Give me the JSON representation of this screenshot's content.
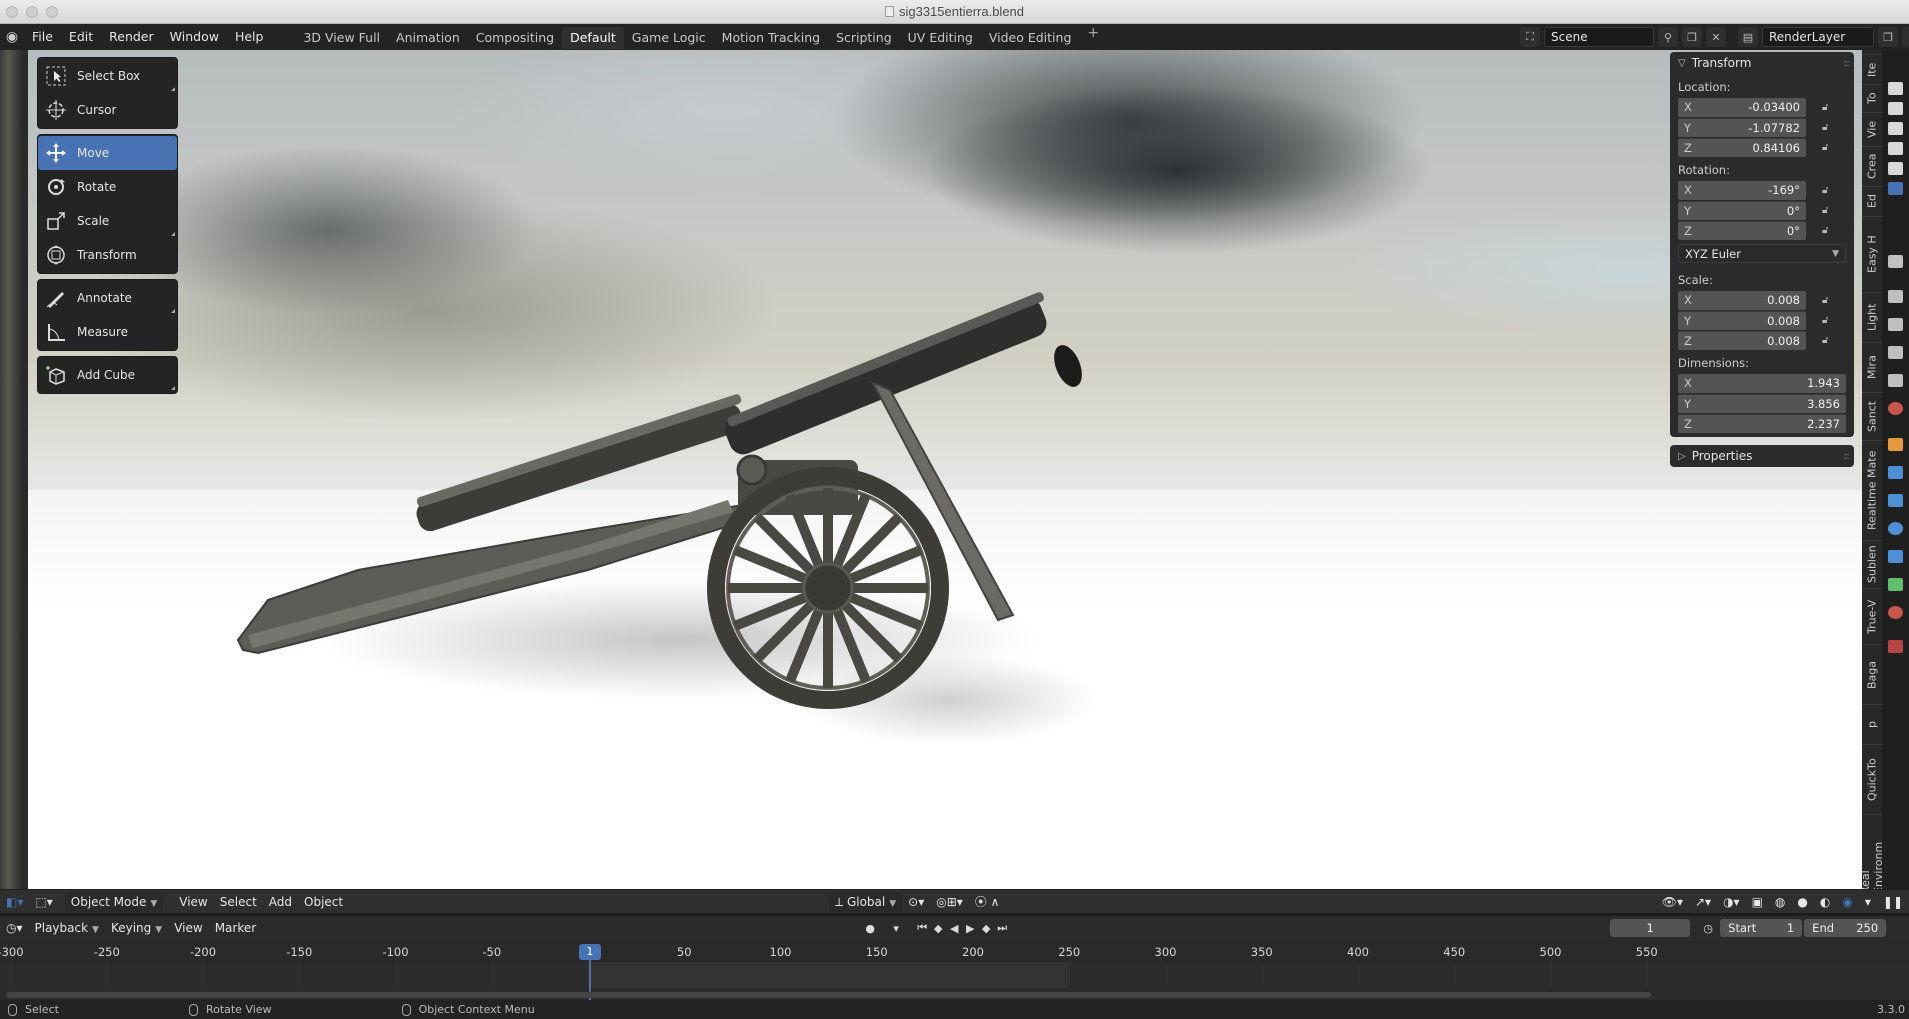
{
  "window": {
    "title": "sig3315entierra.blend"
  },
  "topbar": {
    "menus": [
      "File",
      "Edit",
      "Render",
      "Window",
      "Help"
    ],
    "workspaces": [
      "3D View Full",
      "Animation",
      "Compositing",
      "Default",
      "Game Logic",
      "Motion Tracking",
      "Scripting",
      "UV Editing",
      "Video Editing"
    ],
    "active_workspace": "Default",
    "add_tab": "+",
    "scene": "Scene",
    "view_layer": "RenderLayer"
  },
  "toolbar": {
    "groups": [
      [
        {
          "label": "Select Box",
          "icon": "select-box-icon"
        },
        {
          "label": "Cursor",
          "icon": "cursor-icon"
        }
      ],
      [
        {
          "label": "Move",
          "icon": "move-icon",
          "active": true
        },
        {
          "label": "Rotate",
          "icon": "rotate-icon"
        },
        {
          "label": "Scale",
          "icon": "scale-icon"
        },
        {
          "label": "Transform",
          "icon": "transform-icon"
        }
      ],
      [
        {
          "label": "Annotate",
          "icon": "annotate-icon"
        },
        {
          "label": "Measure",
          "icon": "measure-icon"
        }
      ],
      [
        {
          "label": "Add Cube",
          "icon": "add-cube-icon"
        }
      ]
    ]
  },
  "transform_panel": {
    "title": "Transform",
    "location_label": "Location:",
    "location": [
      {
        "axis": "X",
        "value": "-0.03400"
      },
      {
        "axis": "Y",
        "value": "-1.07782"
      },
      {
        "axis": "Z",
        "value": "0.84106"
      }
    ],
    "rotation_label": "Rotation:",
    "rotation": [
      {
        "axis": "X",
        "value": "-169°"
      },
      {
        "axis": "Y",
        "value": "0°"
      },
      {
        "axis": "Z",
        "value": "0°"
      }
    ],
    "rotation_mode": "XYZ Euler",
    "scale_label": "Scale:",
    "scale": [
      {
        "axis": "X",
        "value": "0.008"
      },
      {
        "axis": "Y",
        "value": "0.008"
      },
      {
        "axis": "Z",
        "value": "0.008"
      }
    ],
    "dimensions_label": "Dimensions:",
    "dimensions": [
      {
        "axis": "X",
        "value": "1.943"
      },
      {
        "axis": "Y",
        "value": "3.856"
      },
      {
        "axis": "Z",
        "value": "2.237"
      }
    ],
    "properties_title": "Properties"
  },
  "side_tabs": [
    "Ite",
    "To",
    "Vie",
    "Crea",
    "Ed",
    "Easy H",
    "Light",
    "Mira",
    "Sanct",
    "Realtime Mate",
    "Sublen",
    "True-V",
    "Baga",
    "p",
    "QuickTo",
    "Real Environm"
  ],
  "viewport_header": {
    "mode": "Object Mode",
    "menus": [
      "View",
      "Select",
      "Add",
      "Object"
    ],
    "orientation": "Global"
  },
  "timeline_header": {
    "menus": [
      "Playback",
      "Keying",
      "View",
      "Marker"
    ],
    "current_frame": "1",
    "start_label": "Start",
    "start": "1",
    "end_label": "End",
    "end": "250"
  },
  "timeline": {
    "ticks": [
      "-300",
      "-250",
      "-200",
      "-150",
      "-100",
      "-50",
      "50",
      "100",
      "150",
      "200",
      "250",
      "300",
      "350",
      "400",
      "450",
      "500",
      "550"
    ],
    "playhead": "1"
  },
  "statusbar": {
    "items": [
      "Select",
      "Rotate View",
      "Object Context Menu"
    ],
    "version": "3.3.0"
  },
  "colors": {
    "accent": "#4772b3",
    "panel": "#2b2b2b",
    "field": "#545454"
  }
}
